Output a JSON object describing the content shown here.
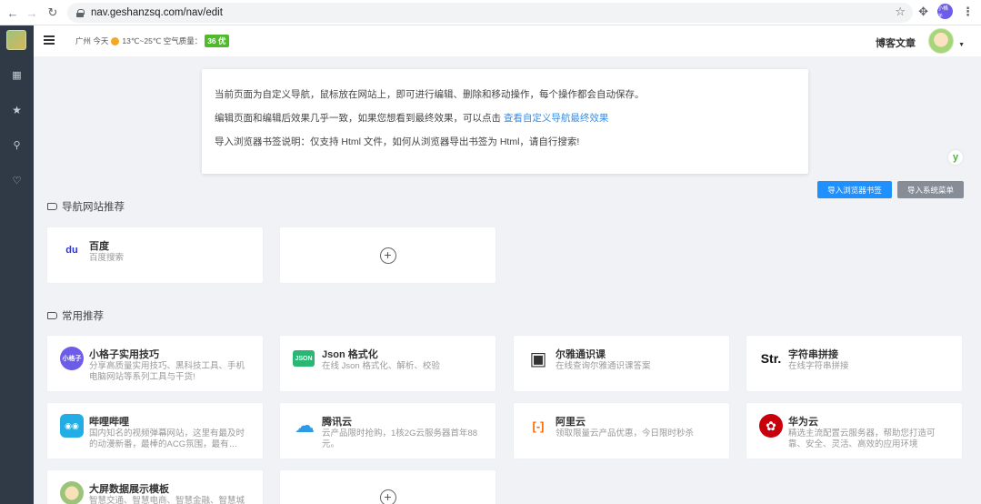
{
  "browser": {
    "url": "nav.geshanzsq.com/nav/edit",
    "profile_label": "小格子"
  },
  "header": {
    "weather_city": "广州 今天",
    "weather_temp": "13℃~25℃ 空气质量：",
    "aqi": "36 优",
    "blog_link": "博客文章"
  },
  "notice": {
    "line1": "当前页面为自定义导航，鼠标放在网站上，即可进行编辑、删除和移动操作，每个操作都会自动保存。",
    "line2_prefix": "编辑页面和编辑后效果几乎一致，如果您想看到最终效果，可以点击 ",
    "line2_link": "查看自定义导航最终效果",
    "line3": "导入浏览器书签说明：仅支持 Html 文件，如何从浏览器导出书签为 Html，请自行搜索!"
  },
  "buttons": {
    "import_bookmarks": "导入浏览器书签",
    "import_system": "导入系统菜单"
  },
  "sections": {
    "nav_title": "导航网站推荐",
    "common_title": "常用推荐"
  },
  "nav_cards": [
    {
      "title": "百度",
      "desc": "百度搜索",
      "icon": "baidu-paw-icon",
      "icon_text": "du",
      "color": "#2932e1"
    }
  ],
  "common_cards": [
    {
      "title": "小格子实用技巧",
      "desc": "分享高质量实用技巧、黑科技工具、手机电脑网站等系列工具与干货!",
      "icon_text": "小格子",
      "color": "#6c5ce7"
    },
    {
      "title": "Json 格式化",
      "desc": "在线 Json 格式化、解析、校验",
      "icon_text": "JSON",
      "color": "#2bb673"
    },
    {
      "title": "尔雅通识课",
      "desc": "在线查询尔雅通识课答案",
      "icon_text": "▣",
      "color": "#333333"
    },
    {
      "title": "字符串拼接",
      "desc": "在线字符串拼接",
      "icon_text": "Str.",
      "color": "#ffffff"
    },
    {
      "title": "哔哩哔哩",
      "desc": "国内知名的视频弹幕网站，这里有最及时的动漫新番，最棒的ACG氛围，最有…",
      "icon_text": "◉◉",
      "color": "#23ade5"
    },
    {
      "title": "腾讯云",
      "desc": "云产品限时抢购，1核2G云服务器首年88元。",
      "icon_text": "☁",
      "color": "#2d9ae8"
    },
    {
      "title": "阿里云",
      "desc": "领取限量云产品优惠，今日限时秒杀",
      "icon_text": "[-]",
      "color": "#ff6a00"
    },
    {
      "title": "华为云",
      "desc": "精选主流配置云服务器，帮助您打造可靠、安全、灵活、高效的应用环境",
      "icon_text": "✿",
      "color": "#c7000b"
    },
    {
      "title": "大屏数据展示模板",
      "desc": "智慧交通、智慧电商、智慧金融、智慧城",
      "icon_text": "",
      "color": "#9bc47a"
    }
  ]
}
